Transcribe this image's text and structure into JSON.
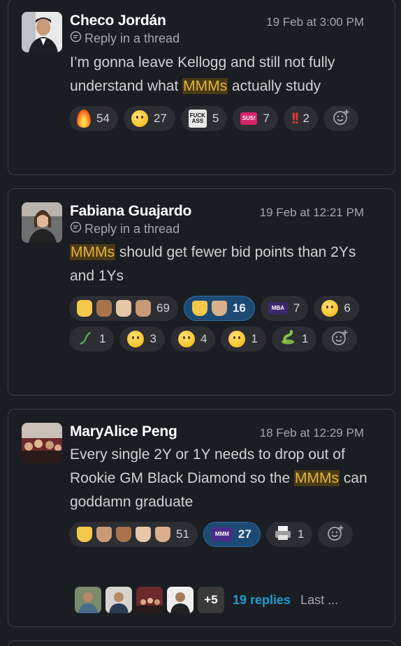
{
  "messages": [
    {
      "author": "Checo Jordán",
      "time": "19 Feb at 3:00 PM",
      "thread_label": "Reply in a thread",
      "text_before": "I’m gonna leave Kellogg and still not fully understand what ",
      "highlight": "MMMs",
      "text_after": " actually study",
      "reactions": [
        {
          "icon": "fire-emoji",
          "count": "54"
        },
        {
          "icon": "laughing-emoji",
          "count": "27"
        },
        {
          "icon": "custom-fuck-ass-emoji",
          "label": "FUCK ASS",
          "count": "5"
        },
        {
          "icon": "custom-sus-emoji",
          "label": "SUS!",
          "count": "7"
        },
        {
          "icon": "double-exclamation-emoji",
          "label": "!!",
          "count": "2"
        }
      ]
    },
    {
      "author": "Fabiana Guajardo",
      "time": "19 Feb at 12:21 PM",
      "thread_label": "Reply in a thread",
      "highlight": "MMMs",
      "text_after": " should get fewer bid points than 2Ys and 1Ys",
      "reactions": [
        {
          "icon": "raised-hands-emoji-set",
          "count": "69"
        },
        {
          "icon": "thumbs-down-emoji-set",
          "count": "16",
          "active": true
        },
        {
          "icon": "custom-mba-emoji",
          "label": "MBA",
          "count": "7"
        },
        {
          "icon": "shushing-face-emoji",
          "count": "6"
        },
        {
          "icon": "lizard-emoji",
          "count": "1"
        },
        {
          "icon": "surprised-face-emoji",
          "count": "3"
        },
        {
          "icon": "laughing-emoji",
          "count": "4"
        },
        {
          "icon": "thinking-face-emoji",
          "count": "1"
        },
        {
          "icon": "snake-emoji",
          "count": "1"
        }
      ]
    },
    {
      "author": "MaryAlice Peng",
      "time": "18 Feb at 12:29 PM",
      "text_before": "Every single 2Y or 1Y needs to drop out of Rookie GM Black Diamond so the ",
      "highlight": "MMMs",
      "text_after": " can goddamn graduate",
      "reactions": [
        {
          "icon": "thumbs-down-emoji-set",
          "count": "51"
        },
        {
          "icon": "custom-mmm-emoji",
          "label": "MMM",
          "count": "27",
          "active": true
        },
        {
          "icon": "printer-emoji",
          "count": "1"
        }
      ],
      "replies": {
        "extra": "+5",
        "label": "19 replies",
        "last": "Last ..."
      }
    }
  ],
  "colors": {
    "accent": "#1d9bd1",
    "highlight_bg": "#4a3b17",
    "highlight_text": "#e8b339",
    "active_reaction": "#1d4a73"
  }
}
